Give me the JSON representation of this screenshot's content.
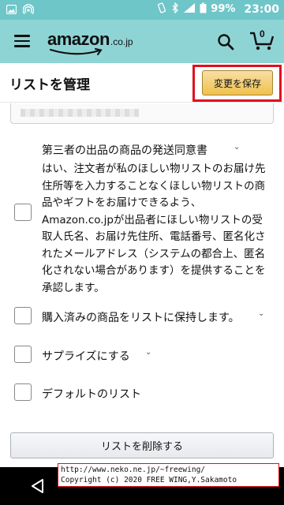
{
  "status_bar": {
    "battery": "99%",
    "time": "23:00",
    "network": "4G"
  },
  "header": {
    "logo_text": "amazon",
    "logo_suffix": ".co.jp",
    "cart_count": "0"
  },
  "page": {
    "title": "リストを管理",
    "save_label": "変更を保存"
  },
  "options": [
    {
      "label": "第三者の出品の商品の発送同意書",
      "checked": false,
      "has_chevron": true
    },
    {
      "label": "購入済みの商品をリストに保持します。",
      "checked": false,
      "has_chevron": true
    },
    {
      "label": "サプライズにする",
      "checked": false,
      "has_chevron": true
    },
    {
      "label": "デフォルトのリスト",
      "checked": false,
      "has_chevron": false
    }
  ],
  "consent_text": "はい、注文者が私のほしい物リストのお届け先住所等を入力することなくほしい物リストの商品やギフトをお届けできるよう、Amazon.co.jpが出品者にほしい物リストの受取人氏名、お届け先住所、電話番号、匿名化されたメールアドレス（システムの都合上、匿名化されない場合があります）を提供することを承認します。",
  "delete_label": "リストを削除する",
  "watermark": {
    "line1": "http://www.neko.ne.jp/~freewing/",
    "line2": "Copyright (c) 2020 FREE WING,Y.Sakamoto"
  },
  "colors": {
    "header": "#8ed4d5",
    "status_bar": "#6fc6c9",
    "save_button": "#f0c14b",
    "highlight": "#e0101e"
  }
}
